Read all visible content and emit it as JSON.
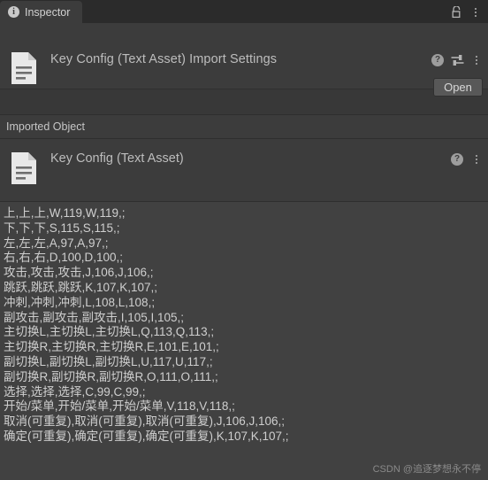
{
  "window": {
    "tab": {
      "label": "Inspector",
      "info_icon": "info-icon",
      "lock_icon": "lock-icon",
      "menu_icon": "kebab-menu-icon"
    }
  },
  "import_settings": {
    "icon": "text-asset-icon",
    "title": "Key Config (Text Asset) Import Settings",
    "help_icon": "help-icon",
    "preset_icon": "preset-icon",
    "menu_icon": "kebab-menu-icon",
    "open_label": "Open"
  },
  "imported_object": {
    "section_label": "Imported Object",
    "icon": "text-asset-icon",
    "title": "Key Config (Text Asset)",
    "help_icon": "help-icon",
    "menu_icon": "kebab-menu-icon"
  },
  "text_preview": {
    "lines": [
      "上,上,上,W,119,W,119,;",
      "下,下,下,S,115,S,115,;",
      "左,左,左,A,97,A,97,;",
      "右,右,右,D,100,D,100,;",
      "攻击,攻击,攻击,J,106,J,106,;",
      "跳跃,跳跃,跳跃,K,107,K,107,;",
      "冲刺,冲刺,冲刺,L,108,L,108,;",
      "副攻击,副攻击,副攻击,I,105,I,105,;",
      "主切换L,主切换L,主切换L,Q,113,Q,113,;",
      "主切换R,主切换R,主切换R,E,101,E,101,;",
      "副切换L,副切换L,副切换L,U,117,U,117,;",
      "副切换R,副切换R,副切换R,O,111,O,111,;",
      "选择,选择,选择,C,99,C,99,;",
      "开始/菜单,开始/菜单,开始/菜单,V,118,V,118,;",
      "取消(可重复),取消(可重复),取消(可重复),J,106,J,106,;",
      "确定(可重复),确定(可重复),确定(可重复),K,107,K,107,;"
    ],
    "watermark": "CSDN @追逐梦想永不停"
  },
  "colors": {
    "window_bg": "#383838",
    "panel_bg": "#3c3c3c",
    "tabbar_bg": "#2b2b2b",
    "text_area_bg": "#414141",
    "text_color": "#cfcfcf",
    "button_bg": "#585858"
  }
}
